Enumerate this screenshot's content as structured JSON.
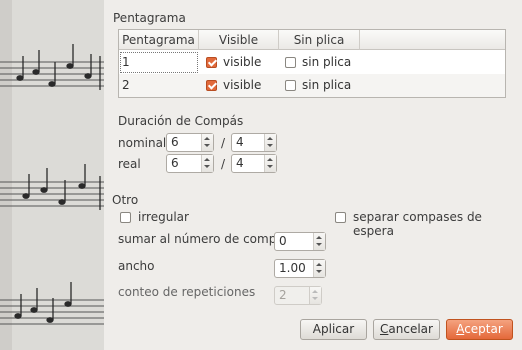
{
  "pentagrama": {
    "title": "Pentagrama",
    "headers": [
      "Pentagrama",
      "Visible",
      "Sin plica"
    ],
    "rows": [
      {
        "num": "1",
        "visible_label": "visible",
        "visible_checked": true,
        "sinplica_label": "sin plica",
        "sinplica_checked": false
      },
      {
        "num": "2",
        "visible_label": "visible",
        "visible_checked": true,
        "sinplica_label": "sin plica",
        "sinplica_checked": false
      }
    ]
  },
  "duracion": {
    "title": "Duración de Compás",
    "nominal": {
      "label": "nominal",
      "num": "6",
      "sep": "/",
      "den": "4"
    },
    "real": {
      "label": "real",
      "num": "6",
      "sep": "/",
      "den": "4"
    }
  },
  "otro": {
    "title": "Otro",
    "irregular_label": "irregular",
    "irregular_checked": false,
    "separar_label": "separar compases de espera",
    "separar_checked": false,
    "sumar_label": "sumar al número de compás",
    "sumar_value": "0",
    "ancho_label": "ancho",
    "ancho_value": "1.00",
    "conteo_label": "conteo de repeticiones",
    "conteo_value": "2"
  },
  "buttons": {
    "aplicar": "Aplicar",
    "cancelar_pre": "C",
    "cancelar_post": "ancelar",
    "aceptar_pre": "A",
    "aceptar_post": "ceptar"
  },
  "colors": {
    "accent": "#e4683a",
    "window_bg": "#efedea"
  }
}
